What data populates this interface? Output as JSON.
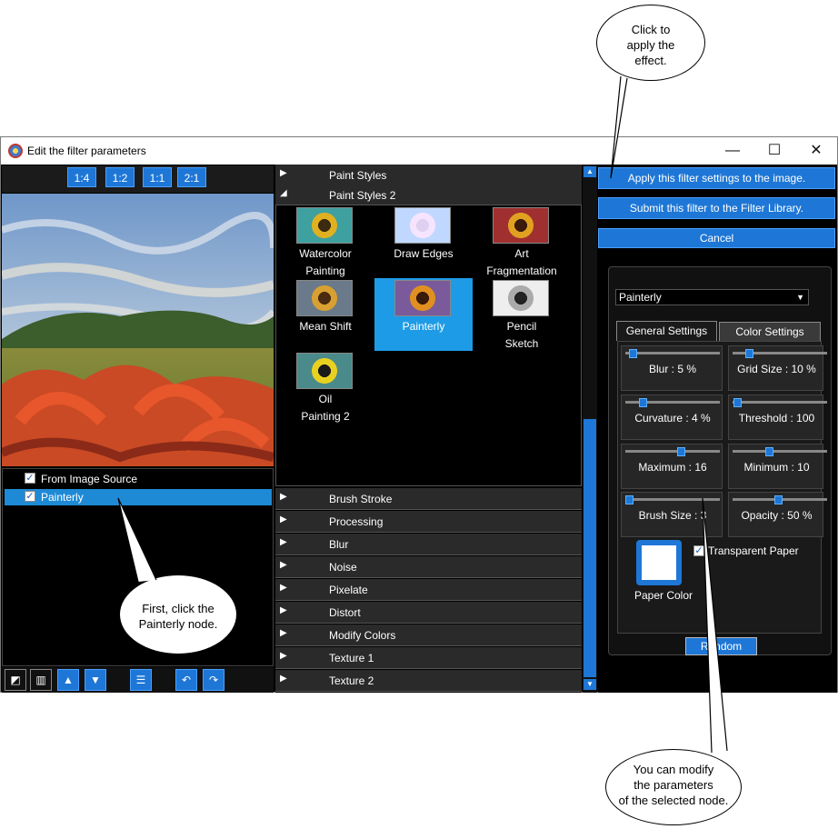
{
  "window": {
    "title": "Edit the filter parameters",
    "controls": [
      "—",
      "☐",
      "✕"
    ]
  },
  "zoom": [
    "1:4",
    "1:2",
    "1:1",
    "2:1"
  ],
  "node_tree": [
    {
      "label": "From Image Source",
      "checked": true,
      "selected": false
    },
    {
      "label": "Painterly",
      "checked": true,
      "selected": true
    }
  ],
  "bottom_tools": [
    "new-icon",
    "delete-icon",
    "up-icon",
    "down-icon",
    "menu-icon",
    "undo-icon",
    "redo-icon"
  ],
  "categories_top": [
    {
      "label": "Paint Styles",
      "expanded": false
    },
    {
      "label": "Paint Styles 2",
      "expanded": true
    }
  ],
  "gallery": [
    {
      "label": "Watercolor Painting",
      "line1": "Watercolor",
      "line2": "Painting",
      "selected": false
    },
    {
      "label": "Draw Edges",
      "line1": "Draw Edges",
      "line2": "",
      "selected": false
    },
    {
      "label": "Art Fragmentation",
      "line1": "Art",
      "line2": "Fragmentation",
      "selected": false
    },
    {
      "label": "Mean Shift",
      "line1": "Mean Shift",
      "line2": "",
      "selected": false
    },
    {
      "label": "Painterly",
      "line1": "Painterly",
      "line2": "",
      "selected": true
    },
    {
      "label": "Pencil Sketch",
      "line1": "Pencil",
      "line2": "Sketch",
      "selected": false
    },
    {
      "label": "Oil Painting 2",
      "line1": "Oil",
      "line2": "Painting 2",
      "selected": false
    }
  ],
  "categories_bottom": [
    "Brush Stroke",
    "Processing",
    "Blur",
    "Noise",
    "Pixelate",
    "Distort",
    "Modify Colors",
    "Texture 1",
    "Texture 2"
  ],
  "actions": {
    "apply": "Apply this filter settings to the image.",
    "submit": "Submit this filter to the Filter Library.",
    "cancel": "Cancel"
  },
  "preset": "Painterly",
  "tabs": {
    "general": "General Settings",
    "color": "Color Settings"
  },
  "params": [
    {
      "label": "Blur : 5 %",
      "level": 0.05
    },
    {
      "label": "Grid Size : 10 %",
      "level": 0.1
    },
    {
      "label": "Curvature : 4 %",
      "level": 0.1
    },
    {
      "label": "Threshold : 100",
      "level": 0.0
    },
    {
      "label": "Maximum : 16",
      "level": 0.6
    },
    {
      "label": "Minimum : 10",
      "level": 0.4
    },
    {
      "label": "Brush Size : 3",
      "level": 0.0
    },
    {
      "label": "Opacity : 50 %",
      "level": 0.5
    }
  ],
  "paper": {
    "color_label": "Paper Color",
    "transparent_label": "Transparent Paper",
    "transparent_checked": true
  },
  "random_label": "Random",
  "callouts": {
    "apply": [
      "Click to",
      "apply the",
      "effect."
    ],
    "node": [
      "First, click the",
      "Painterly node."
    ],
    "params": [
      "You can modify",
      "the parameters",
      "of the selected node."
    ]
  }
}
